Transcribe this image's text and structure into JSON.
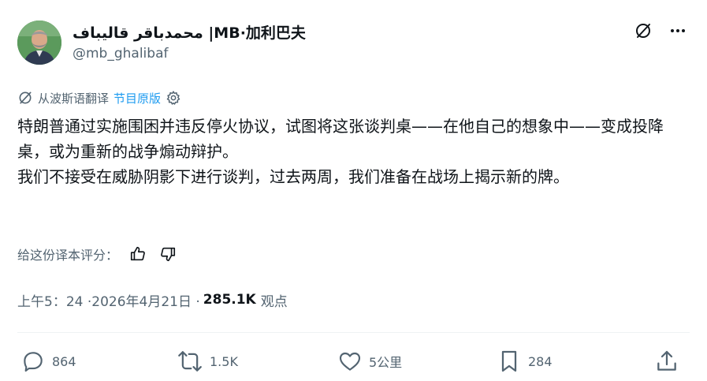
{
  "author": {
    "display_name": "محمدباقر قالیباف |MB·加利巴夫",
    "handle": "@mb_ghalibaf"
  },
  "translation": {
    "label": "从波斯语翻译",
    "source_link": "节目原版"
  },
  "tweet": {
    "text": "特朗普通过实施围困并违反停火协议，试图将这张谈判桌——在他自己的想象中——变成投降桌，或为重新的战争煽动辩护。\n我们不接受在威胁阴影下进行谈判，过去两周，我们准备在战场上揭示新的牌。"
  },
  "rating": {
    "label": "给这份译本评分："
  },
  "meta": {
    "timestamp": "上午5：24 ·2026年4月21日 ·",
    "views_count": "285.1K",
    "views_label": "观点"
  },
  "actions": {
    "replies": "864",
    "reposts": "1.5K",
    "likes": "5公里",
    "bookmarks": "284"
  },
  "icons": {
    "more": "more-horizontal-icon",
    "grok": "grok-slash-icon",
    "settings": "gear-icon",
    "reply": "speech-bubble-icon",
    "repost": "repost-arrows-icon",
    "like": "heart-icon",
    "bookmark": "bookmark-icon",
    "share": "share-upload-icon",
    "thumbs_up": "thumbs-up-icon",
    "thumbs_down": "thumbs-down-icon"
  },
  "colors": {
    "text": "#0f1419",
    "secondary": "#536471",
    "link": "#1d9bf0",
    "divider": "#eff3f4"
  }
}
